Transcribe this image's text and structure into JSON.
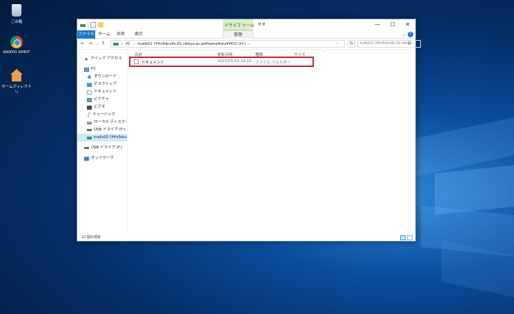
{
  "desktop": {
    "icons": [
      {
        "label": "ごみ箱",
        "icon": "recycle-bin-icon"
      },
      {
        "label": "RIKKYO SPIRIT",
        "icon": "chrome-icon"
      },
      {
        "label": "ホームディレクトリ",
        "icon": "home-directory-icon"
      }
    ]
  },
  "window": {
    "title": "H:¥",
    "contextual_tab_group": "ドライブ ツール",
    "controls": {
      "minimize": "—",
      "maximize": "☐",
      "close": "✕"
    }
  },
  "ribbon": {
    "tabs": [
      "ファイル",
      "ホーム",
      "共有",
      "表示",
      "管理"
    ],
    "help": "?"
  },
  "address": {
    "path": [
      "PC",
      "tcalls02 (¥¥v5dccifs-01.rikkyo.ac.jp¥home¥stu¥¥K2) (H:)"
    ],
    "search_placeholder": "tcalls02 (¥¥v5dccifs-01.rikkyo..."
  },
  "sidebar": {
    "items": [
      {
        "label": "クイック アクセス",
        "icon": "star-icon"
      },
      {
        "label": "PC",
        "icon": "pc-icon"
      },
      {
        "label": "ダウンロード",
        "icon": "download-icon"
      },
      {
        "label": "デスクトップ",
        "icon": "desktop-icon"
      },
      {
        "label": "ドキュメント",
        "icon": "documents-icon"
      },
      {
        "label": "ピクチャ",
        "icon": "pictures-icon"
      },
      {
        "label": "ビデオ",
        "icon": "videos-icon"
      },
      {
        "label": "ミュージック",
        "icon": "music-icon"
      },
      {
        "label": "ローカル ディスク (C:)",
        "icon": "local-disk-icon"
      },
      {
        "label": "USB ドライブ (F:)",
        "icon": "usb-drive-icon"
      },
      {
        "label": "tcalls02 (¥¥v5dccifs",
        "icon": "network-drive-icon"
      },
      {
        "label": "USB ドライブ (F:)",
        "icon": "usb-drive-icon"
      },
      {
        "label": "ネットワーク",
        "icon": "network-icon"
      }
    ]
  },
  "columns": [
    "名前",
    "更新日時",
    "種類",
    "サイズ"
  ],
  "files": [
    {
      "name": "ドキュメント",
      "modified": "2023/05/19 14:22",
      "type": "ファイル フォルダー",
      "size": ""
    }
  ],
  "status": {
    "item_count": "22 個の項目"
  }
}
